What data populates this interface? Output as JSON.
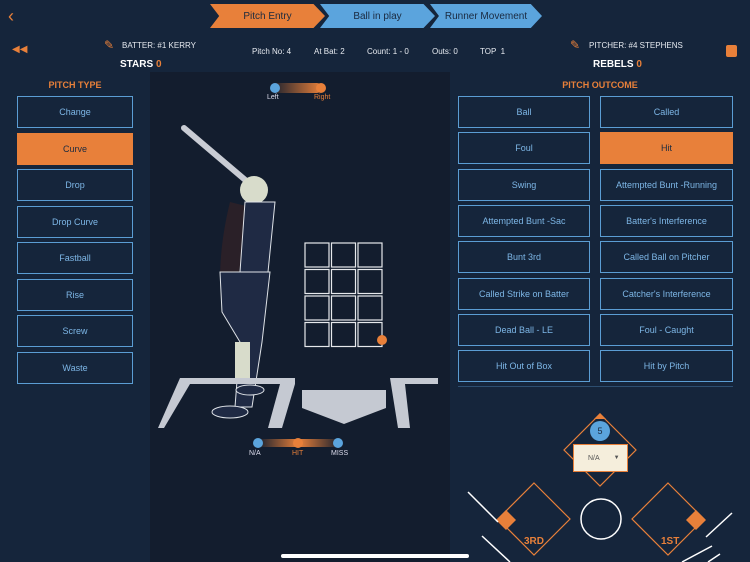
{
  "nav": {
    "back": "back-icon",
    "steps": [
      "Pitch Entry",
      "Ball in play",
      "Runner Movement"
    ],
    "active": 0
  },
  "info": {
    "batter": "BATTER: #1 KERRY",
    "pitcher": "PITCHER: #4 STEPHENS",
    "pitch_no": "Pitch No: 4",
    "at_bat": "At Bat: 2",
    "count": "Count: 1 - 0",
    "outs": "Outs: 0",
    "inning": "TOP  1",
    "home_team": "STARS",
    "home_score": "0",
    "away_team": "REBELS",
    "away_score": "0"
  },
  "pitch_type": {
    "title": "PITCH TYPE",
    "items": [
      "Change",
      "Curve",
      "Drop",
      "Drop Curve",
      "Fastball",
      "Rise",
      "Screw",
      "Waste"
    ],
    "selected": "Curve"
  },
  "pitch_outcome": {
    "title": "PITCH OUTCOME",
    "items": [
      "Ball",
      "Called",
      "Foul",
      "Hit",
      "Swing",
      "Attempted Bunt -Running",
      "Attempted Bunt -Sac",
      "Batter's Interference",
      "Bunt 3rd",
      "Called Ball on Pitcher",
      "Called Strike on Batter",
      "Catcher's Interference",
      "Dead Ball - LE",
      "Foul - Caught",
      "Hit Out of Box",
      "Hit by Pitch"
    ],
    "selected": "Hit"
  },
  "handedness": {
    "left": "Left",
    "right": "Right",
    "selected": "Right"
  },
  "contact": {
    "na": "N/A",
    "hit": "HIT",
    "miss": "MISS",
    "selected": "HIT"
  },
  "field": {
    "fielder_number": "5",
    "fielder_select": "N/A",
    "third": "3RD",
    "first": "1ST"
  },
  "colors": {
    "accent": "#e8803a",
    "blue": "#5b9dd3",
    "bg": "#15253b"
  }
}
